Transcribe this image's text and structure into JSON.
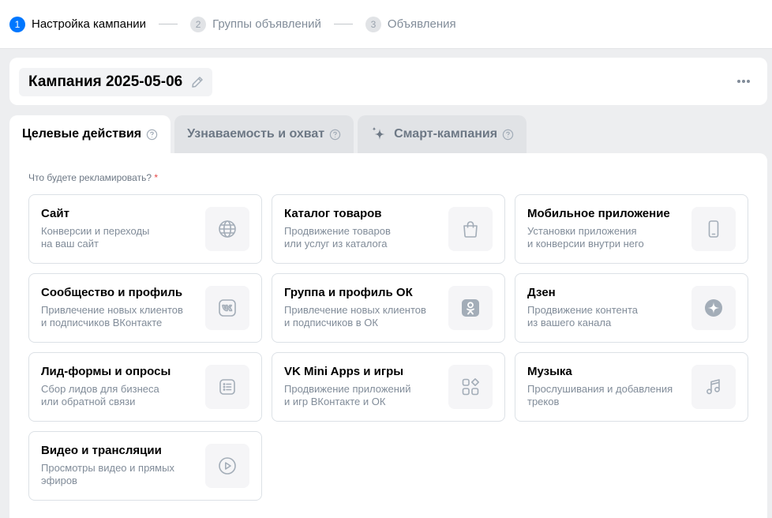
{
  "stepper": {
    "steps": [
      {
        "num": "1",
        "label": "Настройка кампании",
        "active": true
      },
      {
        "num": "2",
        "label": "Группы объявлений",
        "active": false
      },
      {
        "num": "3",
        "label": "Объявления",
        "active": false
      }
    ]
  },
  "campaign": {
    "name": "Кампания 2025-05-06",
    "icons": {
      "edit": "pencil-icon",
      "more": "more-dots-icon"
    }
  },
  "tabs": [
    {
      "label": "Целевые действия",
      "active": true
    },
    {
      "label": "Узнаваемость и охват",
      "active": false
    },
    {
      "label": "Смарт-кампания",
      "active": false,
      "icon": "sparkle-icon"
    }
  ],
  "objective": {
    "question": "Что будете рекламировать?",
    "required_mark": "*",
    "cards": [
      {
        "title": "Сайт",
        "desc1": "Конверсии и переходы",
        "desc2": "на ваш сайт",
        "icon": "globe-icon"
      },
      {
        "title": "Каталог товаров",
        "desc1": "Продвижение товаров",
        "desc2": "или услуг из каталога",
        "icon": "shopping-bag-icon"
      },
      {
        "title": "Мобильное приложение",
        "desc1": "Установки приложения",
        "desc2": "и конверсии внутри него",
        "icon": "smartphone-icon"
      },
      {
        "title": "Сообщество и профиль",
        "desc1": "Привлечение новых клиентов",
        "desc2": "и подписчиков ВКонтакте",
        "icon": "vk-logo-icon"
      },
      {
        "title": "Группа и профиль ОК",
        "desc1": "Привлечение новых клиентов",
        "desc2": "и подписчиков в ОК",
        "icon": "ok-logo-icon"
      },
      {
        "title": "Дзен",
        "desc1": "Продвижение контента",
        "desc2": "из вашего канала",
        "icon": "dzen-logo-icon"
      },
      {
        "title": "Лид-формы и опросы",
        "desc1": "Сбор лидов для бизнеса",
        "desc2": "или обратной связи",
        "icon": "list-form-icon"
      },
      {
        "title": "VK Mini Apps и игры",
        "desc1": "Продвижение приложений",
        "desc2": "и игр ВКонтакте и ОК",
        "icon": "apps-grid-icon"
      },
      {
        "title": "Музыка",
        "desc1": "Прослушивания и добавления",
        "desc2": "треков",
        "icon": "music-note-icon"
      },
      {
        "title": "Видео и трансляции",
        "desc1": "Просмотры видео и прямых",
        "desc2": "эфиров",
        "icon": "play-circle-icon"
      }
    ]
  },
  "colors": {
    "accent": "#0077ff",
    "page_bg": "#edeef0",
    "secondary_text": "#818c99",
    "icon_gray": "#a3adb8",
    "required": "#e64646"
  }
}
